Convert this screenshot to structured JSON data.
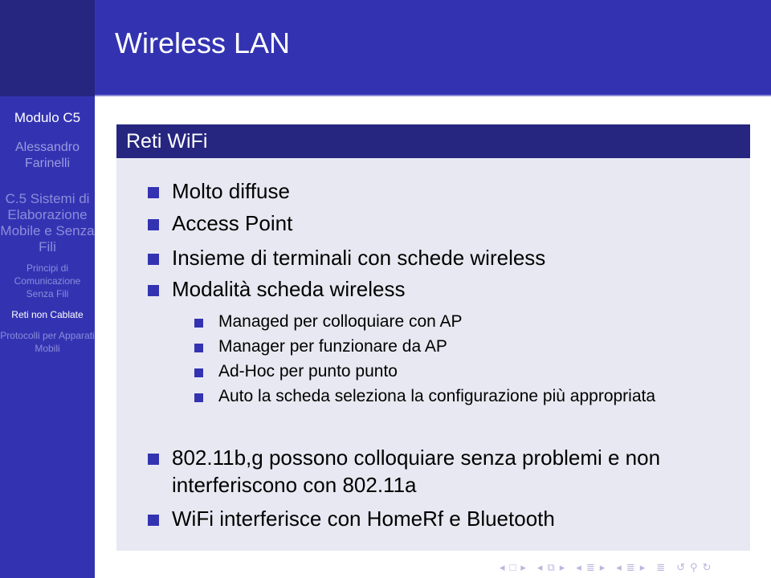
{
  "frame": {
    "title": "Wireless LAN"
  },
  "sidebar": {
    "module": "Modulo C5",
    "author": "Alessandro Farinelli",
    "course": "C.5 Sistemi di Elaborazione Mobile e Senza Fili",
    "sections": [
      {
        "label": "Principi di Comunicazione Senza Fili",
        "active": false
      },
      {
        "label": "Reti non Cablate",
        "active": true
      },
      {
        "label": "Protocolli per Apparati Mobili",
        "active": false
      }
    ]
  },
  "block": {
    "title": "Reti WiFi",
    "items": [
      {
        "text": "Molto diffuse"
      },
      {
        "text": "Access Point"
      },
      {
        "text": "Insieme di terminali con schede wireless"
      },
      {
        "text": "Modalità scheda wireless",
        "subitems": [
          "Managed per colloquiare con AP",
          "Manager per funzionare da AP",
          "Ad-Hoc per punto punto",
          "Auto la scheda seleziona la configurazione più appropriata"
        ]
      },
      {
        "text": "802.11b,g possono colloquiare senza problemi e non interferiscono con 802.11a"
      },
      {
        "text": "WiFi interferisce con HomeRf e Bluetooth"
      }
    ]
  },
  "navigation": {
    "icons": [
      "prev-slide-icon",
      "slide-icon",
      "next-slide-icon",
      "prev-frame-icon",
      "frame-icon",
      "next-frame-icon",
      "prev-subsection-icon",
      "subsection-icon",
      "next-subsection-icon",
      "prev-section-icon",
      "section-icon",
      "next-section-icon",
      "document-icon",
      "back-icon",
      "search-icon",
      "forward-icon"
    ]
  },
  "colors": {
    "sidebar": "#3333b2",
    "header": "#3333b2",
    "block_title": "#262680",
    "block_body": "#e8e8f2",
    "bullet": "#3333b2"
  }
}
